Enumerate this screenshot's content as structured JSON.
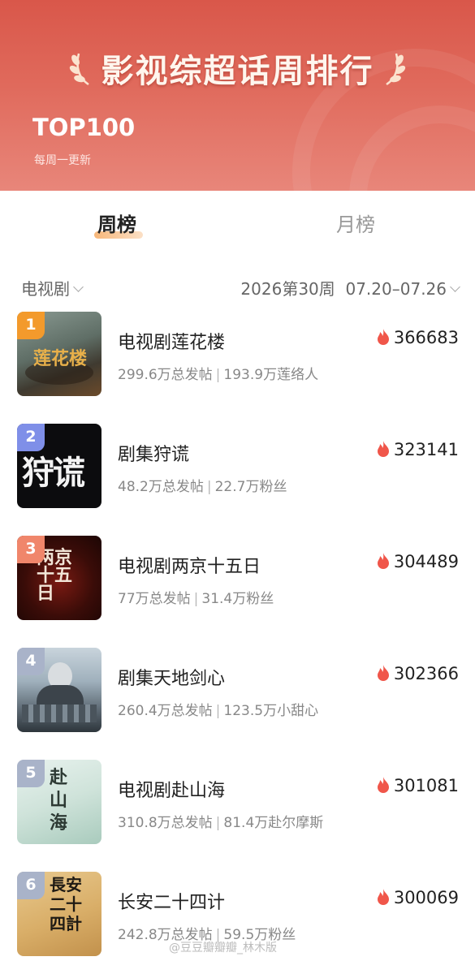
{
  "header": {
    "title": "影视综超话周排行",
    "subtitle": "TOP100",
    "update_note": "每周一更新"
  },
  "tabs": [
    {
      "label": "周榜",
      "active": true
    },
    {
      "label": "月榜",
      "active": false
    }
  ],
  "filter": {
    "category": "电视剧",
    "period": "2026第30周  07.20–07.26"
  },
  "items": [
    {
      "rank": "1",
      "name": "电视剧莲花楼",
      "posts": "299.6万总发帖",
      "fans": "193.9万莲络人",
      "heat": "366683",
      "poster_text": "莲花楼",
      "rank_color": "#f39a2c"
    },
    {
      "rank": "2",
      "name": "剧集狩谎",
      "posts": "48.2万总发帖",
      "fans": "22.7万粉丝",
      "heat": "323141",
      "poster_text": "狩谎",
      "rank_color": "#7f8fe8"
    },
    {
      "rank": "3",
      "name": "电视剧两京十五日",
      "posts": "77万总发帖",
      "fans": "31.4万粉丝",
      "heat": "304489",
      "poster_text": "两京十五日",
      "rank_color": "#f0866b"
    },
    {
      "rank": "4",
      "name": "剧集天地剑心",
      "posts": "260.4万总发帖",
      "fans": "123.5万小甜心",
      "heat": "302366",
      "poster_text": "",
      "rank_color": "#a9b3c9"
    },
    {
      "rank": "5",
      "name": "电视剧赴山海",
      "posts": "310.8万总发帖",
      "fans": "81.4万赴尔摩斯",
      "heat": "301081",
      "poster_text": "赴山海",
      "rank_color": "#a9b3c9"
    },
    {
      "rank": "6",
      "name": "长安二十四计",
      "posts": "242.8万总发帖",
      "fans": "59.5万粉丝",
      "heat": "300069",
      "poster_text": "長安二十四計",
      "rank_color": "#a9b3c9"
    }
  ],
  "icons": {
    "heat": "flame-icon",
    "dropdown": "chevron-down-icon",
    "decoration": "laurel-icon"
  },
  "colors": {
    "header": "#d9574a",
    "heat": "#f0564a",
    "active_tab_underline": "#f7b77a"
  },
  "watermark": "@豆豆瓣瓣瓣_林木版"
}
